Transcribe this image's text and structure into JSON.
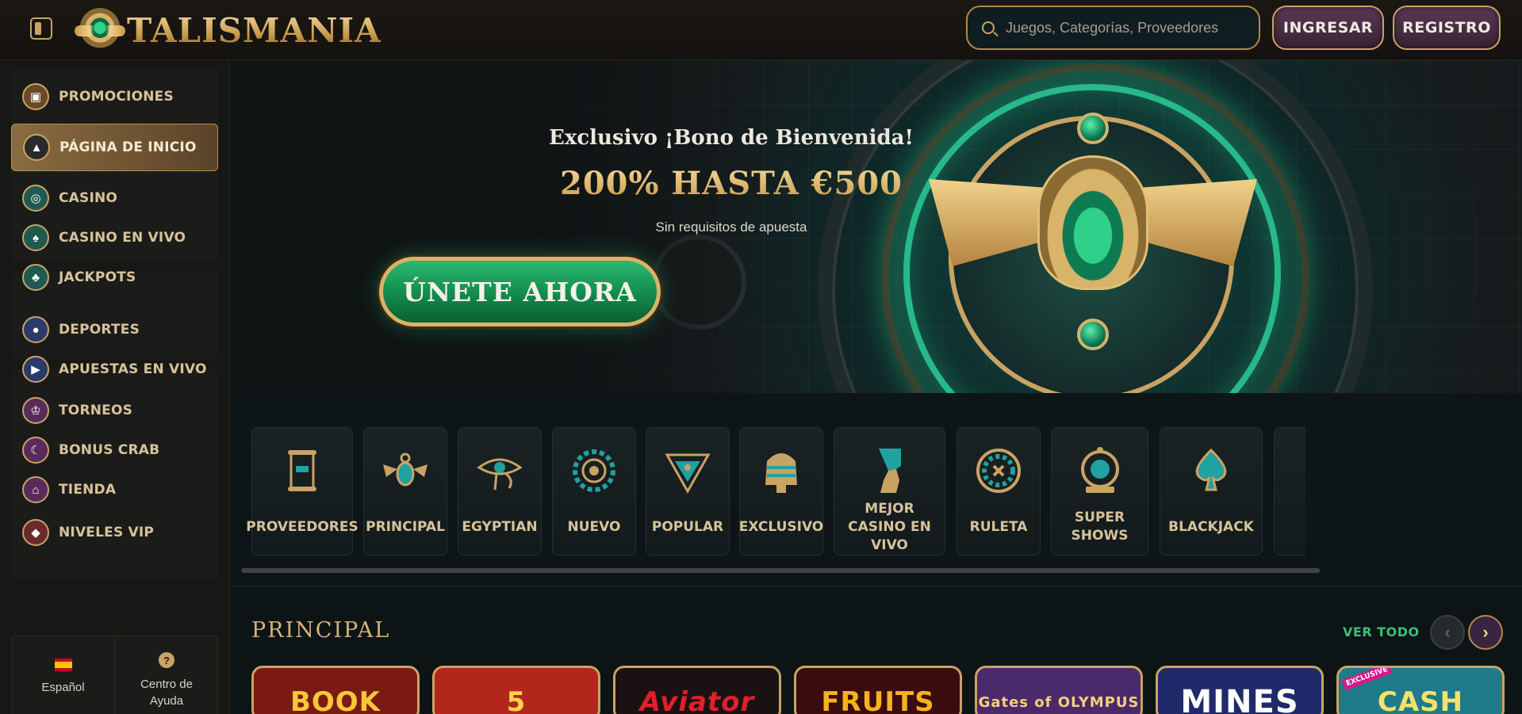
{
  "header": {
    "logo_text": "TALISMANIA",
    "search_placeholder": "Juegos, Categorías, Proveedores",
    "login_label": "INGRESAR",
    "register_label": "REGISTRO"
  },
  "sidebar": {
    "items": [
      {
        "label": "PROMOCIONES",
        "icon": "treasure-chest-icon"
      },
      {
        "label": "PÁGINA DE INICIO",
        "icon": "pyramid-icon"
      },
      {
        "label": "CASINO",
        "icon": "chip-icon"
      },
      {
        "label": "CASINO EN VIVO",
        "icon": "spade-icon"
      },
      {
        "label": "JACKPOTS",
        "icon": "clover-icon"
      },
      {
        "label": "DEPORTES",
        "icon": "soccer-ball-icon"
      },
      {
        "label": "APUESTAS EN VIVO",
        "icon": "live-play-icon"
      },
      {
        "label": "TORNEOS",
        "icon": "trophy-icon"
      },
      {
        "label": "BONUS CRAB",
        "icon": "crab-icon"
      },
      {
        "label": "TIENDA",
        "icon": "shop-icon"
      },
      {
        "label": "NIVELES VIP",
        "icon": "diamond-icon"
      }
    ],
    "language_label": "Español",
    "help_label": "Centro de Ayuda"
  },
  "hero": {
    "title": "Exclusivo ¡Bono de Bienvenida!",
    "amount": "200% HASTA €500",
    "subtitle": "Sin requisitos de apuesta",
    "cta_label": "ÚNETE AHORA"
  },
  "categories": [
    {
      "label": "PROVEEDORES",
      "icon": "scroll-icon"
    },
    {
      "label": "PRINCIPAL",
      "icon": "scarab-icon"
    },
    {
      "label": "EGYPTIAN",
      "icon": "eye-of-horus-icon"
    },
    {
      "label": "NUEVO",
      "icon": "sun-disc-icon"
    },
    {
      "label": "POPULAR",
      "icon": "winged-emblem-icon"
    },
    {
      "label": "EXCLUSIVO",
      "icon": "pharaoh-mask-icon"
    },
    {
      "label": "MEJOR CASINO EN VIVO",
      "icon": "nefertiti-icon"
    },
    {
      "label": "RULETA",
      "icon": "roulette-icon"
    },
    {
      "label": "SUPER SHOWS",
      "icon": "wheel-show-icon"
    },
    {
      "label": "BLACKJACK",
      "icon": "spade-card-icon"
    }
  ],
  "section": {
    "title": "PRINCIPAL",
    "view_all": "VER TODO"
  },
  "games": [
    {
      "title": "BOOK",
      "bg": "#7a1a12",
      "fg": "#f7c63a"
    },
    {
      "title": "5",
      "bg": "#b3261c",
      "fg": "#ffd44a"
    },
    {
      "title": "Aviator",
      "bg": "#1a1212",
      "fg": "#e0202a"
    },
    {
      "title": "FRUITS",
      "bg": "#3a0c0c",
      "fg": "#f6b21c"
    },
    {
      "title": "Gates of OLYMPUS",
      "bg": "#4a2a6a",
      "fg": "#f5d07a"
    },
    {
      "title": "MINES",
      "bg": "#1e2a6a",
      "fg": "#ffffff"
    },
    {
      "title": "CASH",
      "bg": "#1f7a8a",
      "fg": "#f4e26a",
      "tag": "EXCLUSIVE"
    }
  ],
  "colors": {
    "accent_gold": "#c9a364",
    "accent_green": "#27b987",
    "bg_dark": "#0d1416"
  }
}
